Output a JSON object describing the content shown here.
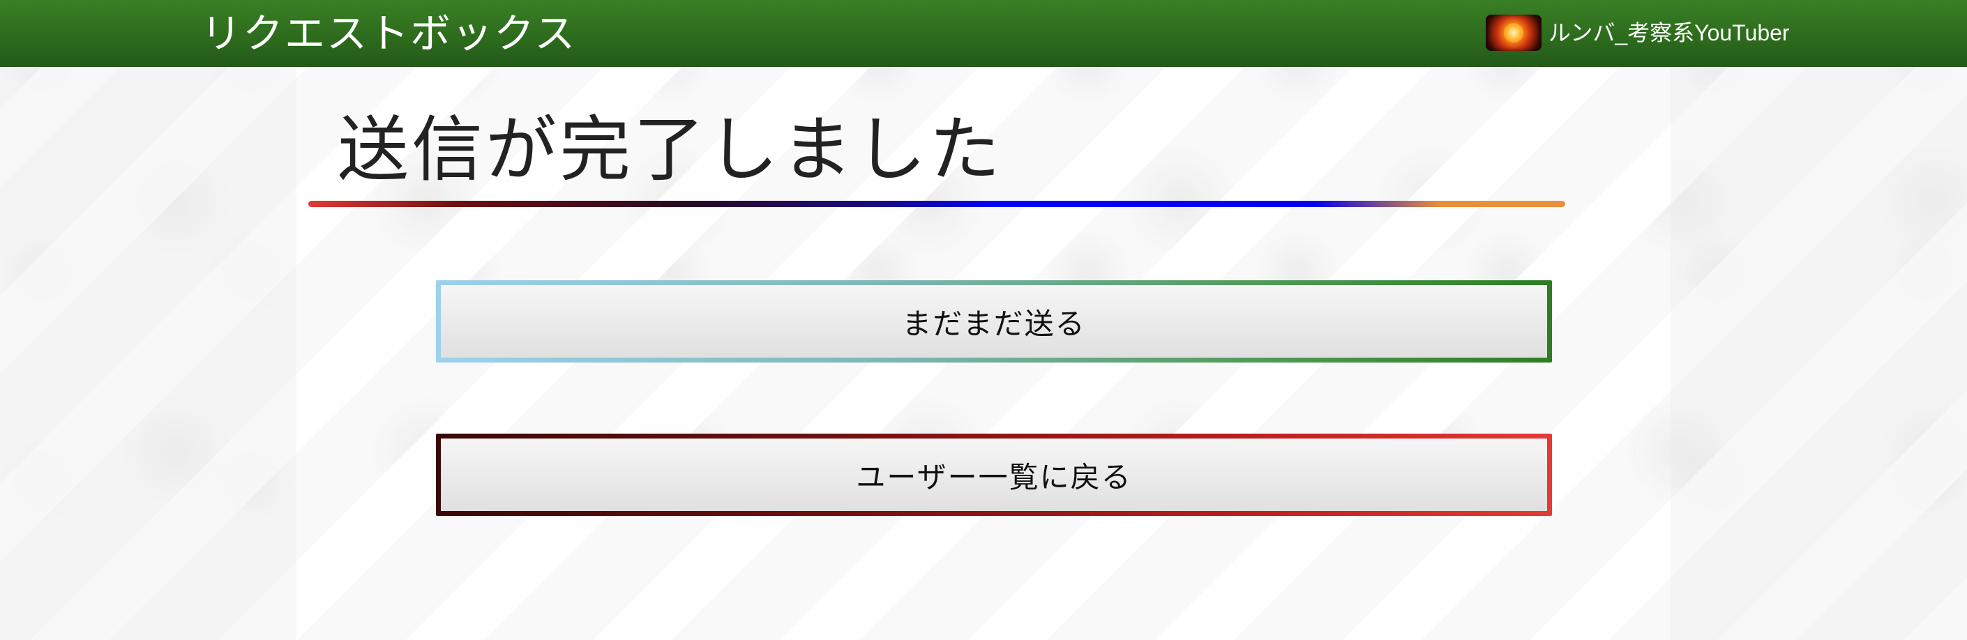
{
  "header": {
    "app_title": "リクエストボックス",
    "user": {
      "name": "ルンバ_考察系YouTuber",
      "avatar_icon": "user-avatar-fire-image"
    },
    "background_color": "#2c6a1c"
  },
  "main": {
    "title": "送信が完了しました",
    "underline_colors": [
      "#e53935",
      "#2a0b24",
      "#0000ff",
      "#e88f3a"
    ],
    "buttons": {
      "send_more_label": "まだまだ送る",
      "back_to_users_label": "ユーザー一覧に戻る"
    },
    "button_border_colors": {
      "send_more": [
        "#9fd0ec",
        "#2e7d22"
      ],
      "back_to_users": [
        "#3a0808",
        "#e53935"
      ]
    }
  }
}
